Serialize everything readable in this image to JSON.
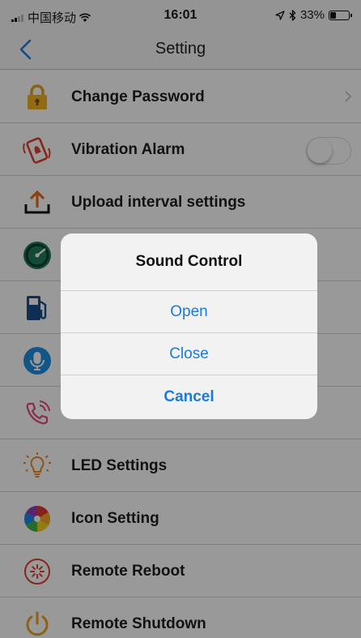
{
  "status_bar": {
    "carrier": "中国移动",
    "time": "16:01",
    "battery_percent": "33%",
    "battery_level": 0.33,
    "wifi_icon": "wifi-icon",
    "location_icon": "location-arrow-icon",
    "bluetooth_icon": "bluetooth-icon"
  },
  "nav": {
    "title": "Setting",
    "back_icon": "chevron-left-icon"
  },
  "settings": {
    "items": [
      {
        "label": "Change Password",
        "icon": "lock-icon",
        "accessory": "chevron"
      },
      {
        "label": "Vibration Alarm",
        "icon": "vibration-alarm-icon",
        "accessory": "toggle",
        "toggle_on": false
      },
      {
        "label": "Upload interval settings",
        "icon": "upload-icon"
      },
      {
        "label": "",
        "icon": "speedometer-icon"
      },
      {
        "label": "",
        "icon": "fuel-pump-icon"
      },
      {
        "label": "",
        "icon": "microphone-icon"
      },
      {
        "label": "",
        "icon": "phone-call-icon"
      },
      {
        "label": "LED Settings",
        "icon": "lightbulb-icon"
      },
      {
        "label": "Icon Setting",
        "icon": "color-wheel-icon"
      },
      {
        "label": "Remote Reboot",
        "icon": "reboot-icon"
      },
      {
        "label": "Remote Shutdown",
        "icon": "power-icon"
      }
    ]
  },
  "dialog": {
    "title": "Sound Control",
    "open_label": "Open",
    "close_label": "Close",
    "cancel_label": "Cancel"
  },
  "colors": {
    "ios_blue": "#1a7bdc",
    "nav_background": "#f7f7f7",
    "overlay": "rgba(0,0,0,0.4)",
    "separator": "#d2d2d2"
  }
}
